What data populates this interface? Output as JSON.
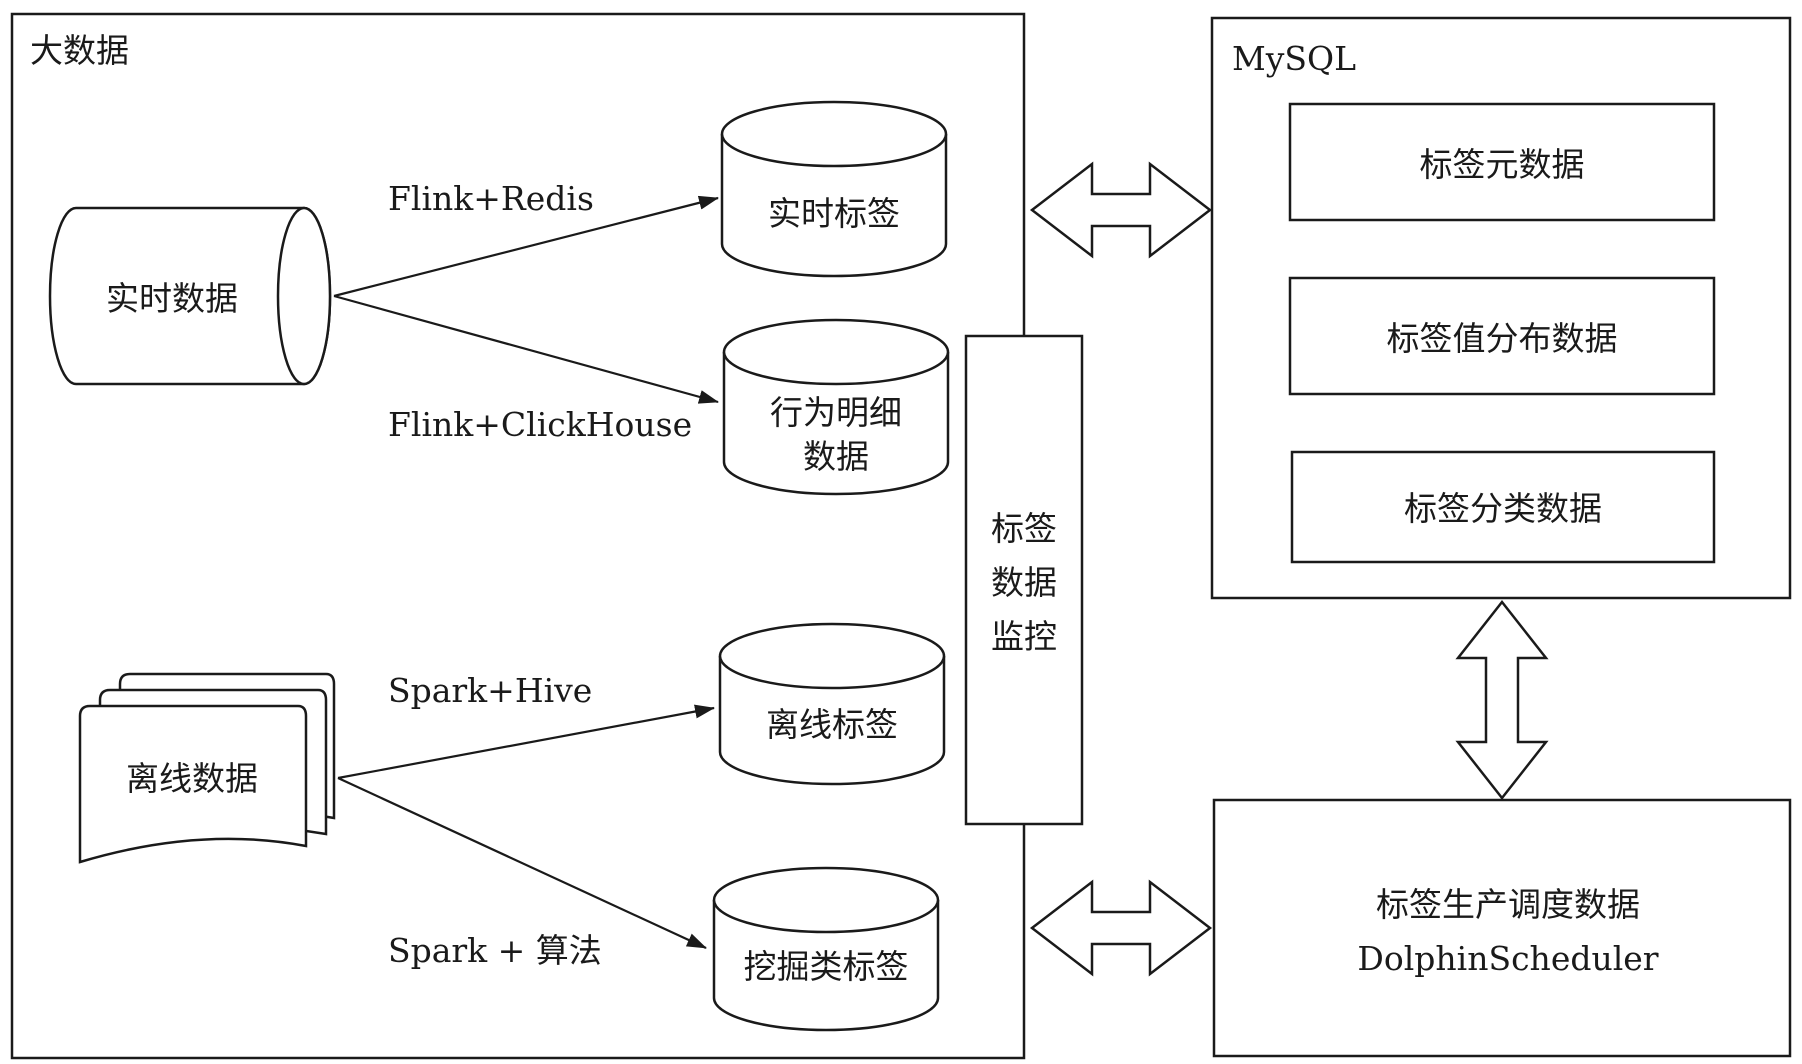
{
  "containers": {
    "bigdata": "大数据",
    "mysql": "MySQL"
  },
  "sources": {
    "realtime": "实时数据",
    "offline": "离线数据"
  },
  "stores": {
    "realtime_tags": "实时标签",
    "behavior_detail_line1": "行为明细",
    "behavior_detail_line2": "数据",
    "offline_tags": "离线标签",
    "mining_tags": "挖掘类标签"
  },
  "edges": {
    "flink_redis": "Flink+Redis",
    "flink_clickhouse": "Flink+ClickHouse",
    "spark_hive": "Spark+Hive",
    "spark_algo": "Spark + 算法"
  },
  "monitor": {
    "line1": "标签",
    "line2": "数据",
    "line3": "监控"
  },
  "mysql_tables": {
    "tag_metadata": "标签元数据",
    "tag_value_distribution": "标签值分布数据",
    "tag_category": "标签分类数据"
  },
  "scheduler": {
    "line1": "标签生产调度数据",
    "line2": "DolphinScheduler"
  }
}
